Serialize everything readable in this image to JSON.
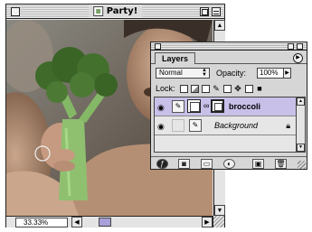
{
  "document": {
    "title": "Party!",
    "zoom": "33.33%"
  },
  "layers_panel": {
    "tab": "Layers",
    "blend_mode": "Normal",
    "opacity_label": "Opacity:",
    "opacity_value": "100%",
    "lock_label": "Lock:",
    "layers": [
      {
        "name": "broccoli",
        "active": true,
        "visible": true
      },
      {
        "name": "Background",
        "active": false,
        "visible": true,
        "locked": true
      }
    ]
  },
  "colors": {
    "selected_row": "#c8c0e8",
    "scroll_thumb": "#a8a0d8",
    "broccoli_green": "#7aa860"
  }
}
